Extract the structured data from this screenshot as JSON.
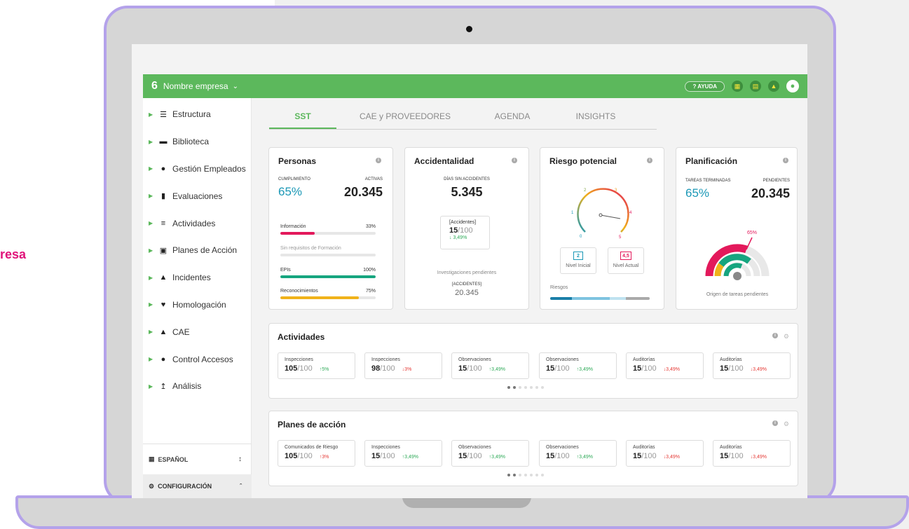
{
  "side_text": "resa",
  "topbar": {
    "logo": "6",
    "company": "Nombre empresa",
    "help_label": "AYUDA"
  },
  "sidebar": {
    "items": [
      {
        "label": "Estructura",
        "icon": "layers-icon"
      },
      {
        "label": "Biblioteca",
        "icon": "folder-icon"
      },
      {
        "label": "Gestión Empleados",
        "icon": "user-edit-icon"
      },
      {
        "label": "Evaluaciones",
        "icon": "clipboard-icon"
      },
      {
        "label": "Actividades",
        "icon": "checklist-icon"
      },
      {
        "label": "Planes de Acción",
        "icon": "calendar-icon"
      },
      {
        "label": "Incidentes",
        "icon": "warning-icon"
      },
      {
        "label": "Homologación",
        "icon": "handshake-icon"
      },
      {
        "label": "CAE",
        "icon": "hierarchy-icon"
      },
      {
        "label": "Control Accesos",
        "icon": "users-lock-icon"
      },
      {
        "label": "Análisis",
        "icon": "chart-line-icon"
      }
    ],
    "language": "ESPAÑOL",
    "config": "CONFIGURACIÓN"
  },
  "tabs": [
    "SST",
    "CAE y PROVEEDORES",
    "AGENDA",
    "INSIGHTS"
  ],
  "personas": {
    "title": "Personas",
    "cumplimiento_label": "CUMPLIMIENTO",
    "cumplimiento": "65%",
    "activas_label": "ACTIVAS",
    "activas": "20.345",
    "bars": [
      {
        "label": "Información",
        "value": "33%",
        "fill": 0.36,
        "color": "#e3195b"
      },
      {
        "label": "Sin requisitos de Formación",
        "value": "",
        "fill": 0,
        "color": "#e7e7e7"
      },
      {
        "label": "EPIs",
        "value": "100%",
        "fill": 1.0,
        "color": "#16a57f"
      },
      {
        "label": "Reconocimientos",
        "value": "75%",
        "fill": 0.82,
        "color": "#f0b21a"
      }
    ]
  },
  "accidentalidad": {
    "title": "Accidentalidad",
    "dias_label": "DÍAS SIN ACCIDENTES",
    "dias": "5.345",
    "box_label": "[Accidentes]",
    "box_value": "15",
    "box_den": "/100",
    "box_change": "↓ 3,49%",
    "inv_label": "Investigaciones pendientes",
    "inv_sub": "[ACCIDENTES]",
    "inv_value": "20.345"
  },
  "riesgo": {
    "title": "Riesgo potencial",
    "ticks": [
      "0",
      "1",
      "2",
      "3",
      "4",
      "5"
    ],
    "inicial_value": "2",
    "inicial_label": "Nivel Inicial",
    "actual_value": "4,5",
    "actual_label": "Nivel Actual",
    "riesgos_label": "Riesgos"
  },
  "planificacion": {
    "title": "Planificación",
    "tareas_label": "TAREAS TERMINADAS",
    "tareas": "65%",
    "pendientes_label": "PENDIENTES",
    "pendientes": "20.345",
    "ring_label": "65%",
    "origen_label": "Origen de tareas pendientes"
  },
  "actividades": {
    "title": "Actividades",
    "kpis": [
      {
        "label": "Inspecciones",
        "value": "105",
        "den": "/100",
        "change": "↑5%",
        "dir": "up"
      },
      {
        "label": "Inspecciones",
        "value": "98",
        "den": "/100",
        "change": "↓3%",
        "dir": "down"
      },
      {
        "label": "Observaciones",
        "value": "15",
        "den": "/100",
        "change": "↑3,49%",
        "dir": "up"
      },
      {
        "label": "Observaciones",
        "value": "15",
        "den": "/100",
        "change": "↑3,49%",
        "dir": "up"
      },
      {
        "label": "Auditorías",
        "value": "15",
        "den": "/100",
        "change": "↓3,49%",
        "dir": "down"
      },
      {
        "label": "Auditorías",
        "value": "15",
        "den": "/100",
        "change": "↓3,49%",
        "dir": "down"
      }
    ]
  },
  "planes": {
    "title": "Planes de acción",
    "kpis": [
      {
        "label": "Comunicados de Riesgo",
        "value": "105",
        "den": "/100",
        "change": "↑3%",
        "dir": "down"
      },
      {
        "label": "Inspecciones",
        "value": "15",
        "den": "/100",
        "change": "↑3,49%",
        "dir": "up"
      },
      {
        "label": "Observaciones",
        "value": "15",
        "den": "/100",
        "change": "↑3,49%",
        "dir": "up"
      },
      {
        "label": "Observaciones",
        "value": "15",
        "den": "/100",
        "change": "↑3,49%",
        "dir": "up"
      },
      {
        "label": "Auditorías",
        "value": "15",
        "den": "/100",
        "change": "↓3,49%",
        "dir": "down"
      },
      {
        "label": "Auditorías",
        "value": "15",
        "den": "/100",
        "change": "↓3,49%",
        "dir": "down"
      }
    ]
  },
  "colors": {
    "brand": "#5cb85c",
    "accent": "#1b98b6",
    "frame": "#b4a2ea",
    "side_text": "#e0137a"
  }
}
